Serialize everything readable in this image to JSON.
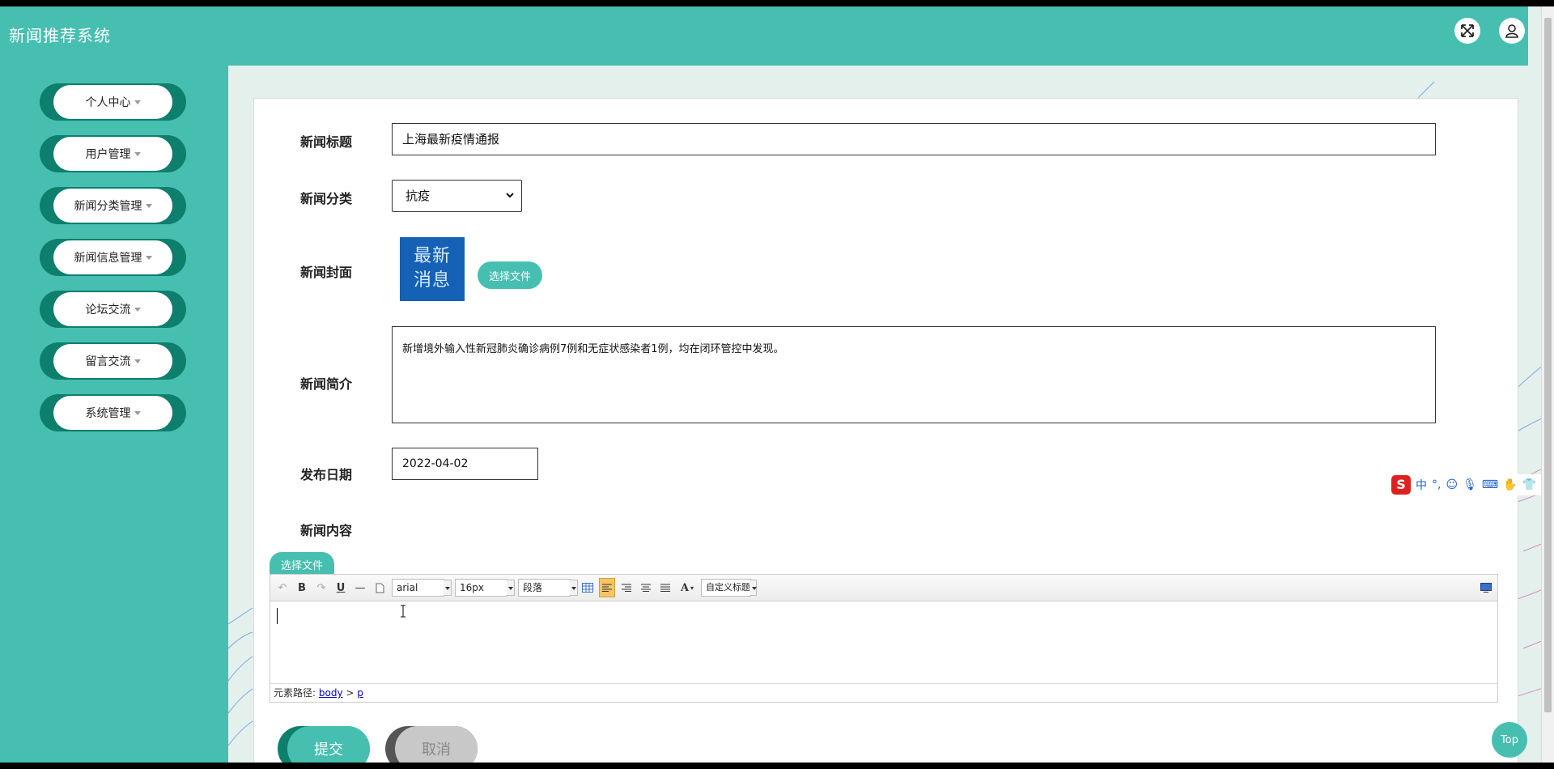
{
  "app": {
    "title": "新闻推荐系统"
  },
  "sidebar": {
    "items": [
      {
        "label": "个人中心"
      },
      {
        "label": "用户管理"
      },
      {
        "label": "新闻分类管理"
      },
      {
        "label": "新闻信息管理"
      },
      {
        "label": "论坛交流"
      },
      {
        "label": "留言交流"
      },
      {
        "label": "系统管理"
      }
    ]
  },
  "form": {
    "title_label": "新闻标题",
    "title_value": "上海最新疫情通报",
    "category_label": "新闻分类",
    "category_value": "抗疫",
    "cover_label": "新闻封面",
    "cover_image_text_line1": "最新",
    "cover_image_text_line2": "消息",
    "cover_button": "选择文件",
    "summary_label": "新闻简介",
    "summary_value": "新增境外输入性新冠肺炎确诊病例7例和无症状感染者1例，均在闭环管控中发现。",
    "date_label": "发布日期",
    "date_value": "2022-04-02",
    "content_label": "新闻内容",
    "content_file_button": "选择文件"
  },
  "editor": {
    "font_family": "arial",
    "font_size": "16px",
    "paragraph": "段落",
    "custom_title": "自定义标题",
    "status_prefix": "元素路径:",
    "path_body": "body",
    "path_sep": ">",
    "path_p": "p"
  },
  "actions": {
    "submit": "提交",
    "cancel": "取消"
  },
  "ime": {
    "logo": "S",
    "mode": "中",
    "punct": "°,"
  },
  "top_button": "Top",
  "colors": {
    "primary": "#46bfb1",
    "primary_dark": "#0d7f6c",
    "cancel": "#c8c8c8"
  }
}
